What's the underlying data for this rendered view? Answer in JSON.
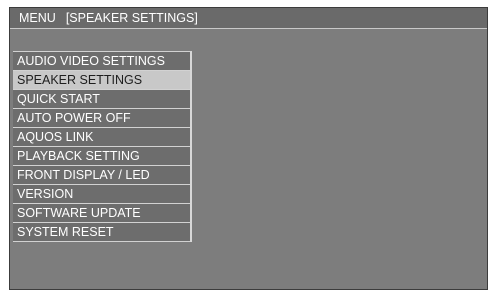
{
  "title_bar": {
    "menu_label": "MENU",
    "current_section": "[SPEAKER SETTINGS]"
  },
  "menu": {
    "selected_index": 1,
    "items": [
      {
        "label": "AUDIO VIDEO SETTINGS"
      },
      {
        "label": "SPEAKER SETTINGS"
      },
      {
        "label": "QUICK START"
      },
      {
        "label": "AUTO POWER OFF"
      },
      {
        "label": "AQUOS LINK"
      },
      {
        "label": "PLAYBACK SETTING"
      },
      {
        "label": "FRONT DISPLAY / LED"
      },
      {
        "label": "VERSION"
      },
      {
        "label": "SOFTWARE UPDATE"
      },
      {
        "label": "SYSTEM RESET"
      }
    ]
  },
  "colors": {
    "screen_background": "#7d7d7d",
    "item_background": "#6d6d6d",
    "selected_background": "#c8c8c8",
    "text": "#ffffff",
    "selected_text": "#1e1e1e"
  }
}
